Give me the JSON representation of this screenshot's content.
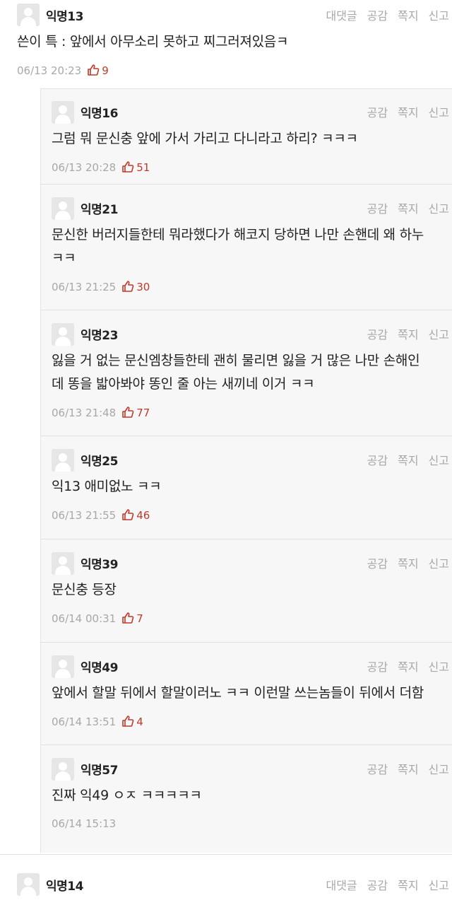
{
  "top_comment": {
    "nick": "익명13",
    "text": "쓴이 특 : 앞에서 아무소리 못하고 찌그러져있음ㅋ",
    "date": "06/13 20:23",
    "votes": "9",
    "actions": [
      "대댓글",
      "공감",
      "쪽지",
      "신고"
    ]
  },
  "replies": [
    {
      "nick": "익명16",
      "lines": [
        "그럼 뭐 문신충 앞에 가서 가리고 다니라고 하리? ㅋㅋㅋ"
      ],
      "date": "06/13 20:28",
      "votes": "51"
    },
    {
      "nick": "익명21",
      "lines": [
        "문신한 버러지들한테 뭐라했다가 해코지 당하면 나만 손핸데 왜 하누",
        "ㅋㅋ"
      ],
      "date": "06/13 21:25",
      "votes": "30"
    },
    {
      "nick": "익명23",
      "lines": [
        "잃을 거 없는 문신엠창들한테 괜히 물리면 잃을 거 많은 나만 손해인",
        "데 똥을 밟아봐야 똥인 줄 아는 새끼네 이거 ㅋㅋ"
      ],
      "date": "06/13 21:48",
      "votes": "77"
    },
    {
      "nick": "익명25",
      "lines": [
        "익13 애미없노 ㅋㅋ"
      ],
      "date": "06/13 21:55",
      "votes": "46"
    },
    {
      "nick": "익명39",
      "lines": [
        "문신충 등장"
      ],
      "date": "06/14 00:31",
      "votes": "7"
    },
    {
      "nick": "익명49",
      "lines": [
        "앞에서 할말 뒤에서 할말이러노 ㅋㅋ 이런말 쓰는놈들이 뒤에서 더함"
      ],
      "date": "06/14 13:51",
      "votes": "4"
    },
    {
      "nick": "익명57",
      "lines": [
        "진짜 익49 ㅇㅈ ㅋㅋㅋㅋㅋ"
      ],
      "date": "06/14 15:13",
      "votes": ""
    }
  ],
  "reply_actions": [
    "공감",
    "쪽지",
    "신고"
  ],
  "next_comment": {
    "nick": "익명14",
    "actions": [
      "대댓글",
      "공감",
      "쪽지",
      "신고"
    ]
  },
  "colors": {
    "vote": "#c0392b",
    "muted": "#a8a8a8",
    "reply_bg": "#f7f7f7"
  }
}
